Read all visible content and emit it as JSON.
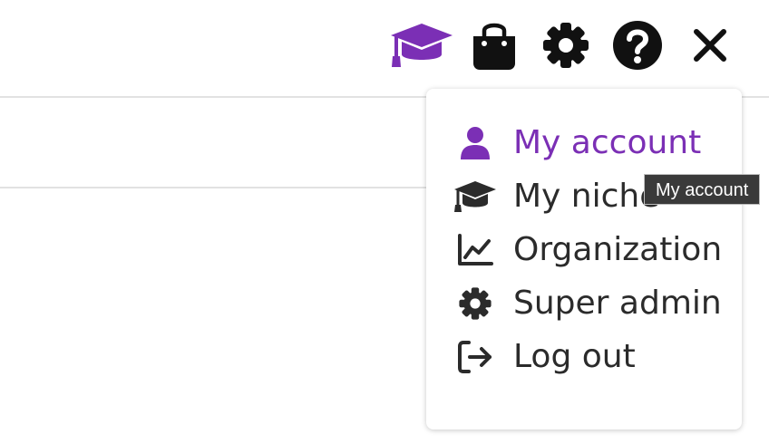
{
  "colors": {
    "accent": "#7b2fb5",
    "text": "#2b2b2b",
    "icon_dark": "#111111",
    "tooltip_bg": "#3a3a3a"
  },
  "toolbar": {
    "icons": [
      "graduation-cap-icon",
      "shopping-bag-icon",
      "gear-icon",
      "help-icon",
      "close-icon"
    ]
  },
  "menu": {
    "items": [
      {
        "label": "My account",
        "icon": "user-icon",
        "active": true
      },
      {
        "label": "My niche",
        "icon": "graduation-cap-icon",
        "active": false
      },
      {
        "label": "Organization",
        "icon": "line-chart-icon",
        "active": false
      },
      {
        "label": "Super admin",
        "icon": "gear-icon",
        "active": false
      },
      {
        "label": "Log out",
        "icon": "logout-icon",
        "active": false
      }
    ]
  },
  "tooltip": {
    "text": "My account"
  }
}
